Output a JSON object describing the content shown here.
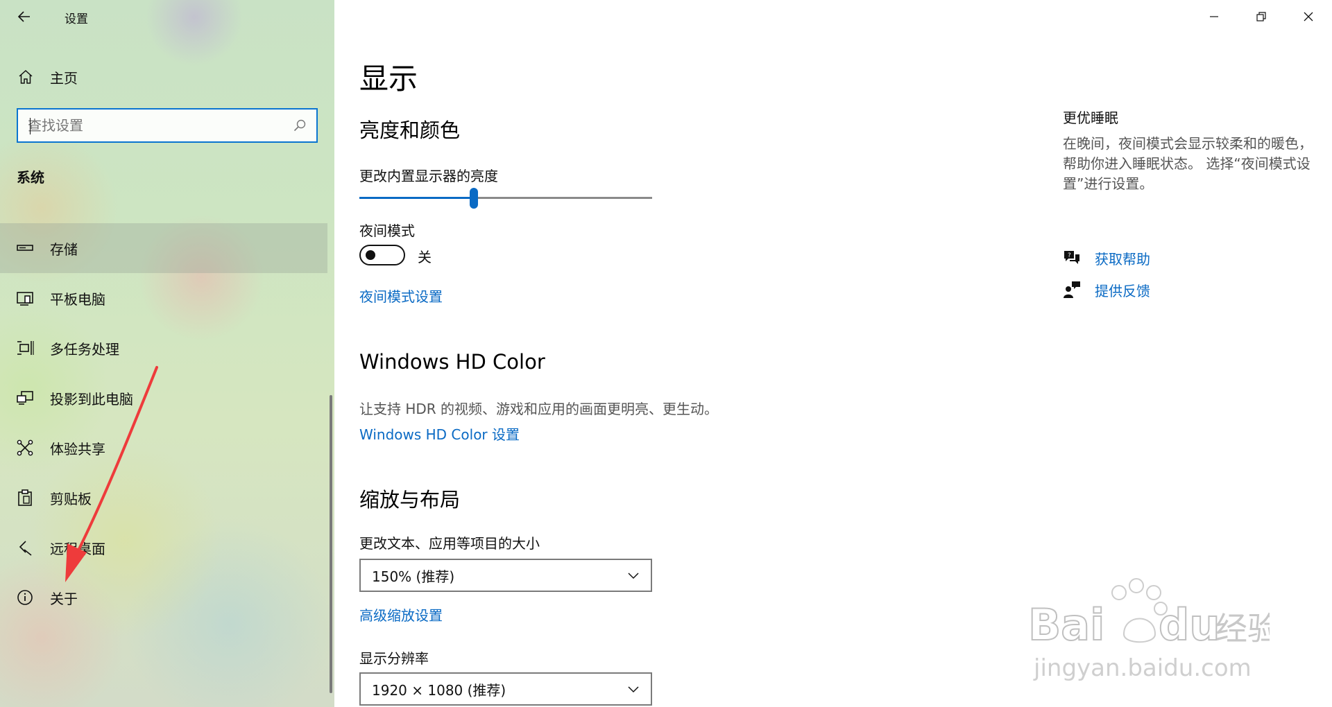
{
  "app": {
    "title": "设置"
  },
  "sidebar": {
    "home_label": "主页",
    "search_placeholder": "查找设置",
    "section_title": "系统",
    "items": [
      {
        "label": "存储",
        "icon": "storage-icon",
        "selected": true
      },
      {
        "label": "平板电脑",
        "icon": "tablet-icon"
      },
      {
        "label": "多任务处理",
        "icon": "multitasking-icon"
      },
      {
        "label": "投影到此电脑",
        "icon": "projecting-icon"
      },
      {
        "label": "体验共享",
        "icon": "shared-experiences-icon"
      },
      {
        "label": "剪贴板",
        "icon": "clipboard-icon"
      },
      {
        "label": "远程桌面",
        "icon": "remote-desktop-icon"
      },
      {
        "label": "关于",
        "icon": "info-icon"
      }
    ]
  },
  "main": {
    "title": "显示",
    "brightness": {
      "heading": "亮度和颜色",
      "slider_label": "更改内置显示器的亮度",
      "slider_value": 0.39
    },
    "night_light": {
      "label": "夜间模式",
      "state": "关",
      "on": false,
      "settings_link": "夜间模式设置"
    },
    "hdr": {
      "heading": "Windows HD Color",
      "description": "让支持 HDR 的视频、游戏和应用的画面更明亮、更生动。",
      "settings_link": "Windows HD Color 设置"
    },
    "scale": {
      "heading": "缩放与布局",
      "scale_label": "更改文本、应用等项目的大小",
      "scale_value": "150% (推荐)",
      "advanced_link": "高级缩放设置",
      "resolution_label": "显示分辨率",
      "resolution_value": "1920 × 1080 (推荐)"
    }
  },
  "aside": {
    "title": "更优睡眠",
    "description": "在晚间，夜间模式会显示较柔和的暖色，帮助你进入睡眠状态。 选择“夜间模式设置”进行设置。",
    "links": [
      {
        "label": "获取帮助",
        "icon": "get-help-icon"
      },
      {
        "label": "提供反馈",
        "icon": "feedback-icon"
      }
    ]
  },
  "colors": {
    "accent": "#0a6ac4",
    "annotation_arrow": "#ee3b3b"
  },
  "watermark": {
    "logo": "Bai du 经验",
    "url": "jingyan.baidu.com"
  }
}
